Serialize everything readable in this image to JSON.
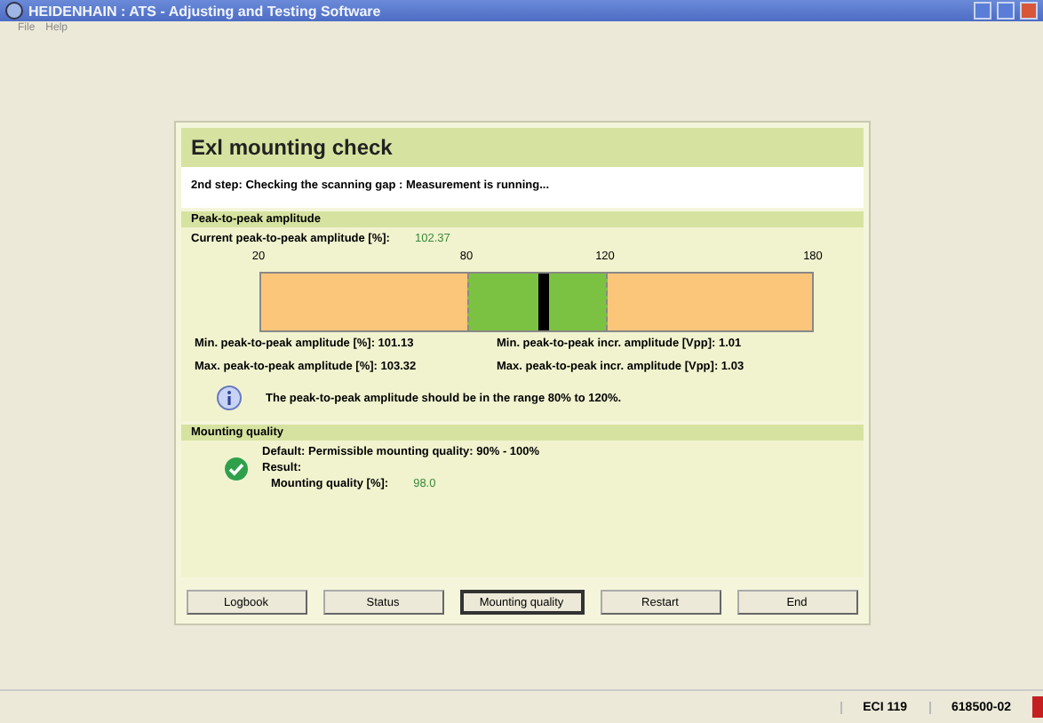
{
  "window": {
    "title": "HEIDENHAIN : ATS - Adjusting and Testing Software"
  },
  "menu": [
    "File",
    "Help"
  ],
  "dialog": {
    "title": "Exl mounting check",
    "step": "2nd step: Checking the scanning gap : Measurement is running...",
    "amplitude": {
      "heading": "Peak-to-peak amplitude",
      "current_label": "Current peak-to-peak amplitude [%]:",
      "current_value": "102.37",
      "ticks": [
        {
          "label": "20",
          "kind": "end"
        },
        {
          "label": "80",
          "kind": "limit"
        },
        {
          "label": "120",
          "kind": "limit"
        },
        {
          "label": "180",
          "kind": "end"
        }
      ],
      "marker": {
        "level": 0.515
      },
      "readings": [
        {
          "label": "Min. peak-to-peak amplitude [%]:",
          "value": "101.13"
        },
        {
          "label": "Min. peak-to-peak incr. amplitude [Vpp]:",
          "value": "1.01"
        },
        {
          "label": "Max. peak-to-peak amplitude [%]:",
          "value": "103.32"
        },
        {
          "label": "Max. peak-to-peak incr. amplitude [Vpp]:",
          "value": "1.03"
        }
      ],
      "info": "The peak-to-peak amplitude should be in the range 80% to 120%."
    },
    "quality": {
      "heading": "Mounting quality",
      "default": "Default: Permissible mounting quality: 90% - 100%",
      "result_label": "Result:",
      "quality_label": "Mounting quality [%]:",
      "quality_value": "98.0"
    },
    "buttons": [
      {
        "label": "Logbook",
        "selected": false
      },
      {
        "label": "Status",
        "selected": false
      },
      {
        "label": "Mounting quality",
        "selected": true
      },
      {
        "label": "Restart",
        "selected": false
      },
      {
        "label": "End",
        "selected": false
      }
    ]
  },
  "status_bar": [
    "ECI 119",
    "618500-02"
  ]
}
